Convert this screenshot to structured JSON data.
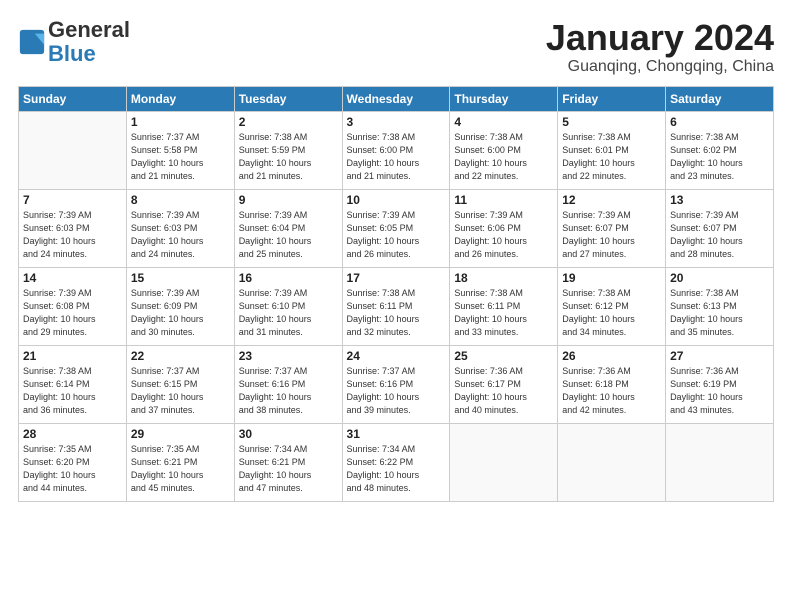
{
  "logo": {
    "general": "General",
    "blue": "Blue"
  },
  "header": {
    "month": "January 2024",
    "location": "Guanqing, Chongqing, China"
  },
  "weekdays": [
    "Sunday",
    "Monday",
    "Tuesday",
    "Wednesday",
    "Thursday",
    "Friday",
    "Saturday"
  ],
  "weeks": [
    [
      {
        "day": "",
        "info": ""
      },
      {
        "day": "1",
        "info": "Sunrise: 7:37 AM\nSunset: 5:58 PM\nDaylight: 10 hours\nand 21 minutes."
      },
      {
        "day": "2",
        "info": "Sunrise: 7:38 AM\nSunset: 5:59 PM\nDaylight: 10 hours\nand 21 minutes."
      },
      {
        "day": "3",
        "info": "Sunrise: 7:38 AM\nSunset: 6:00 PM\nDaylight: 10 hours\nand 21 minutes."
      },
      {
        "day": "4",
        "info": "Sunrise: 7:38 AM\nSunset: 6:00 PM\nDaylight: 10 hours\nand 22 minutes."
      },
      {
        "day": "5",
        "info": "Sunrise: 7:38 AM\nSunset: 6:01 PM\nDaylight: 10 hours\nand 22 minutes."
      },
      {
        "day": "6",
        "info": "Sunrise: 7:38 AM\nSunset: 6:02 PM\nDaylight: 10 hours\nand 23 minutes."
      }
    ],
    [
      {
        "day": "7",
        "info": "Sunrise: 7:39 AM\nSunset: 6:03 PM\nDaylight: 10 hours\nand 24 minutes."
      },
      {
        "day": "8",
        "info": "Sunrise: 7:39 AM\nSunset: 6:03 PM\nDaylight: 10 hours\nand 24 minutes."
      },
      {
        "day": "9",
        "info": "Sunrise: 7:39 AM\nSunset: 6:04 PM\nDaylight: 10 hours\nand 25 minutes."
      },
      {
        "day": "10",
        "info": "Sunrise: 7:39 AM\nSunset: 6:05 PM\nDaylight: 10 hours\nand 26 minutes."
      },
      {
        "day": "11",
        "info": "Sunrise: 7:39 AM\nSunset: 6:06 PM\nDaylight: 10 hours\nand 26 minutes."
      },
      {
        "day": "12",
        "info": "Sunrise: 7:39 AM\nSunset: 6:07 PM\nDaylight: 10 hours\nand 27 minutes."
      },
      {
        "day": "13",
        "info": "Sunrise: 7:39 AM\nSunset: 6:07 PM\nDaylight: 10 hours\nand 28 minutes."
      }
    ],
    [
      {
        "day": "14",
        "info": "Sunrise: 7:39 AM\nSunset: 6:08 PM\nDaylight: 10 hours\nand 29 minutes."
      },
      {
        "day": "15",
        "info": "Sunrise: 7:39 AM\nSunset: 6:09 PM\nDaylight: 10 hours\nand 30 minutes."
      },
      {
        "day": "16",
        "info": "Sunrise: 7:39 AM\nSunset: 6:10 PM\nDaylight: 10 hours\nand 31 minutes."
      },
      {
        "day": "17",
        "info": "Sunrise: 7:38 AM\nSunset: 6:11 PM\nDaylight: 10 hours\nand 32 minutes."
      },
      {
        "day": "18",
        "info": "Sunrise: 7:38 AM\nSunset: 6:11 PM\nDaylight: 10 hours\nand 33 minutes."
      },
      {
        "day": "19",
        "info": "Sunrise: 7:38 AM\nSunset: 6:12 PM\nDaylight: 10 hours\nand 34 minutes."
      },
      {
        "day": "20",
        "info": "Sunrise: 7:38 AM\nSunset: 6:13 PM\nDaylight: 10 hours\nand 35 minutes."
      }
    ],
    [
      {
        "day": "21",
        "info": "Sunrise: 7:38 AM\nSunset: 6:14 PM\nDaylight: 10 hours\nand 36 minutes."
      },
      {
        "day": "22",
        "info": "Sunrise: 7:37 AM\nSunset: 6:15 PM\nDaylight: 10 hours\nand 37 minutes."
      },
      {
        "day": "23",
        "info": "Sunrise: 7:37 AM\nSunset: 6:16 PM\nDaylight: 10 hours\nand 38 minutes."
      },
      {
        "day": "24",
        "info": "Sunrise: 7:37 AM\nSunset: 6:16 PM\nDaylight: 10 hours\nand 39 minutes."
      },
      {
        "day": "25",
        "info": "Sunrise: 7:36 AM\nSunset: 6:17 PM\nDaylight: 10 hours\nand 40 minutes."
      },
      {
        "day": "26",
        "info": "Sunrise: 7:36 AM\nSunset: 6:18 PM\nDaylight: 10 hours\nand 42 minutes."
      },
      {
        "day": "27",
        "info": "Sunrise: 7:36 AM\nSunset: 6:19 PM\nDaylight: 10 hours\nand 43 minutes."
      }
    ],
    [
      {
        "day": "28",
        "info": "Sunrise: 7:35 AM\nSunset: 6:20 PM\nDaylight: 10 hours\nand 44 minutes."
      },
      {
        "day": "29",
        "info": "Sunrise: 7:35 AM\nSunset: 6:21 PM\nDaylight: 10 hours\nand 45 minutes."
      },
      {
        "day": "30",
        "info": "Sunrise: 7:34 AM\nSunset: 6:21 PM\nDaylight: 10 hours\nand 47 minutes."
      },
      {
        "day": "31",
        "info": "Sunrise: 7:34 AM\nSunset: 6:22 PM\nDaylight: 10 hours\nand 48 minutes."
      },
      {
        "day": "",
        "info": ""
      },
      {
        "day": "",
        "info": ""
      },
      {
        "day": "",
        "info": ""
      }
    ]
  ]
}
